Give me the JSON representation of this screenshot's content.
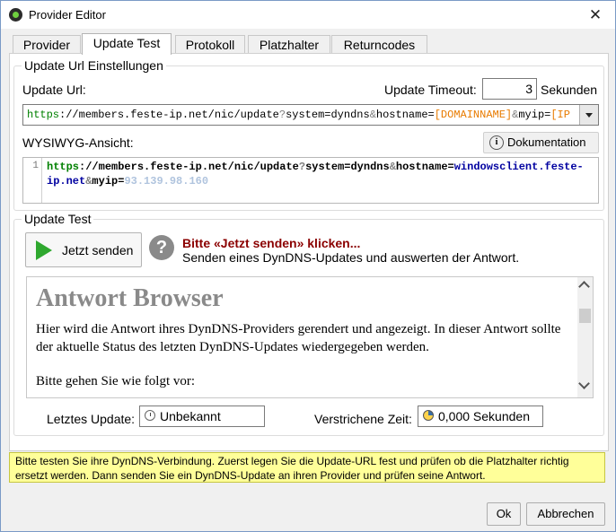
{
  "window": {
    "title": "Provider Editor",
    "close_glyph": "✕"
  },
  "tabs": [
    {
      "label": "Provider"
    },
    {
      "label": "Update Test"
    },
    {
      "label": "Protokoll"
    },
    {
      "label": "Platzhalter"
    },
    {
      "label": "Returncodes"
    }
  ],
  "settings": {
    "group_title": "Update Url Einstellungen",
    "url_label": "Update Url:",
    "timeout_label": "Update Timeout:",
    "timeout_value": "3",
    "timeout_unit": "Sekunden",
    "url_parts": [
      {
        "text": "https",
        "color": "#008000"
      },
      {
        "text": "://members.feste-ip.net/nic/update",
        "color": "#000000"
      },
      {
        "text": "?",
        "color": "#7f7f7f"
      },
      {
        "text": "system",
        "color": "#000000"
      },
      {
        "text": "=",
        "color": "#000000"
      },
      {
        "text": "dyndns",
        "color": "#000000"
      },
      {
        "text": "&",
        "color": "#7f7f7f"
      },
      {
        "text": "hostname",
        "color": "#000000"
      },
      {
        "text": "=",
        "color": "#000000"
      },
      {
        "text": "[DOMAINNAME]",
        "color": "#e87b00"
      },
      {
        "text": "&",
        "color": "#7f7f7f"
      },
      {
        "text": "myip",
        "color": "#000000"
      },
      {
        "text": "=",
        "color": "#000000"
      },
      {
        "text": "[IP",
        "color": "#e87b00"
      }
    ],
    "wysiwyg_label": "WYSIWYG-Ansicht:",
    "doc_button": "Dokumentation",
    "line_number": "1",
    "preview_line1_parts": [
      {
        "text": "https",
        "color": "#008000"
      },
      {
        "text": "://members.feste-ip.net/nic/update",
        "color": "#000000"
      },
      {
        "text": "?",
        "color": "#7f7f7f"
      },
      {
        "text": "system",
        "color": "#000000"
      },
      {
        "text": "=",
        "color": "#000000"
      },
      {
        "text": "dyndns",
        "color": "#000000"
      },
      {
        "text": "&",
        "color": "#7f7f7f"
      },
      {
        "text": "hostname",
        "color": "#000000"
      },
      {
        "text": "=",
        "color": "#000000"
      },
      {
        "text": "windowsclient.feste-",
        "color": "#0000a0"
      }
    ],
    "preview_line2_parts": [
      {
        "text": "ip.net",
        "color": "#0000a0"
      },
      {
        "text": "&",
        "color": "#7f7f7f"
      },
      {
        "text": "myip",
        "color": "#000000"
      },
      {
        "text": "=",
        "color": "#000000"
      },
      {
        "text": "93.139.98.160",
        "color": "#b0c4de"
      }
    ]
  },
  "test": {
    "group_title": "Update Test",
    "send_button": "Jetzt senden",
    "prompt_title": "Bitte «Jetzt senden» klicken...",
    "prompt_sub": "Senden eines DynDNS-Updates und auswerten der Antwort.",
    "browser_heading": "Antwort Browser",
    "browser_para": "Hier wird die Antwort ihres DynDNS-Providers gerendert und angezeigt. In dieser Antwort sollte der aktuelle Status des letzten DynDNS-Updates wiedergegeben werden.",
    "browser_para2": "Bitte gehen Sie wie folgt vor:",
    "last_update_label": "Letztes Update:",
    "last_update_value": "Unbekannt",
    "elapsed_label": "Verstrichene Zeit:",
    "elapsed_value": "0,000 Sekunden"
  },
  "hint": {
    "text": "Bitte testen Sie ihre DynDNS-Verbindung. Zuerst legen Sie die Update-URL fest und prüfen ob die Platzhalter richtig ersetzt werden. Dann senden Sie ein DynDNS-Update an ihren Provider und prüfen seine Antwort."
  },
  "footer": {
    "ok": "Ok",
    "cancel": "Abbrechen"
  }
}
